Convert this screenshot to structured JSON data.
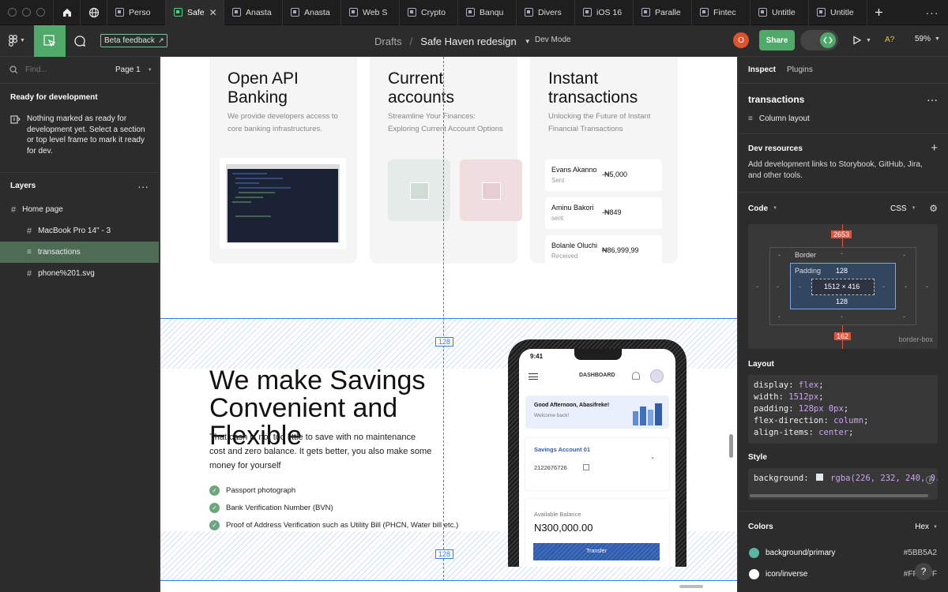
{
  "tabs": [
    {
      "label": "Perso",
      "active": false
    },
    {
      "label": "Safe",
      "active": true
    },
    {
      "label": "Anasta",
      "active": false
    },
    {
      "label": "Anasta",
      "active": false
    },
    {
      "label": "Web S",
      "active": false
    },
    {
      "label": "Crypto",
      "active": false
    },
    {
      "label": "Banqu",
      "active": false
    },
    {
      "label": "Divers",
      "active": false
    },
    {
      "label": "iOS 16",
      "active": false
    },
    {
      "label": "Paralle",
      "active": false
    },
    {
      "label": "Fintec",
      "active": false
    },
    {
      "label": "Untitle",
      "active": false
    },
    {
      "label": "Untitle",
      "active": false
    }
  ],
  "toolbar": {
    "beta_label": "Beta feedback",
    "breadcrumb_parent": "Drafts",
    "breadcrumb_sep": "/",
    "file_name": "Safe Haven redesign",
    "dev_mode": "Dev Mode",
    "avatar_initial": "O",
    "share_label": "Share",
    "font_badge": "A?",
    "zoom": "59%"
  },
  "left": {
    "find_placeholder": "Find...",
    "page_label": "Page 1",
    "ready_title": "Ready for development",
    "ready_text": "Nothing marked as ready for development yet. Select a section or top level frame to mark it ready for dev.",
    "layers_title": "Layers",
    "layers": [
      {
        "label": "Home page",
        "indent": false,
        "icon": "frame",
        "selected": false
      },
      {
        "label": "MacBook Pro 14\" - 3",
        "indent": true,
        "icon": "frame",
        "selected": false
      },
      {
        "label": "transactions",
        "indent": true,
        "icon": "column",
        "selected": true
      },
      {
        "label": "phone%201.svg",
        "indent": true,
        "icon": "frame",
        "selected": false
      }
    ]
  },
  "canvas": {
    "cards": [
      {
        "title": "Open API Banking",
        "desc": "We provide developers access to core banking infrastructures."
      },
      {
        "title": "Current accounts",
        "desc": "Streamline Your Finances: Exploring Current Account Options"
      },
      {
        "title": "Instant transactions",
        "desc": "Unlocking the Future of Instant Financial Transactions"
      }
    ],
    "transactions": [
      {
        "name": "Evans Akanno",
        "status": "Sent",
        "amount": "-₦5,000"
      },
      {
        "name": "Aminu Bakori",
        "status": "sent",
        "amount": "-₦849"
      },
      {
        "name": "Bolanle Oluchi",
        "status": "Received",
        "amount": "₦86,999,99"
      }
    ],
    "hero_title": "We make Savings Convenient and Flexible",
    "hero_text": "That cash is not too little to save with no maintenance cost and zero balance. It gets better, you also make some money for yourself",
    "checklist": [
      "Passport photograph",
      "Bank Verification Number (BVN)",
      "Proof of Address Verification such as Utility Bill (PHCN, Water bill etc.)"
    ],
    "padding_badge_top": "128",
    "padding_badge_bottom": "128",
    "phone": {
      "time": "9:41",
      "header": "DASHBOARD",
      "greeting": "Good Afternoon, Abasifreke!",
      "welcome": "Welcome back!",
      "account_name": "Savings Account 01",
      "account_number": "2122676726",
      "balance_label": "Available Balance",
      "balance": "N300,000.00",
      "transfer": "Transfer"
    }
  },
  "right": {
    "tabs": [
      "Inspect",
      "Plugins"
    ],
    "layer_name": "transactions",
    "layout_type": "Column layout",
    "dev_resources_title": "Dev resources",
    "dev_resources_text": "Add development links to Storybook, GitHub, Jira, and other tools.",
    "code_title": "Code",
    "code_lang": "CSS",
    "box": {
      "top": "2653",
      "border_label": "Border",
      "padding_label": "Padding",
      "padding_top": "128",
      "size": "1512 × 416",
      "padding_bottom": "128",
      "bottom": "162",
      "dash": "-",
      "sizing": "border-box"
    },
    "layout_title": "Layout",
    "layout_css": [
      {
        "prop": "display",
        "val": "flex"
      },
      {
        "prop": "width",
        "val": "1512px"
      },
      {
        "prop": "padding",
        "val": "128px 0px"
      },
      {
        "prop": "flex-direction",
        "val": "column"
      },
      {
        "prop": "align-items",
        "val": "center"
      }
    ],
    "style_title": "Style",
    "style_prop": "background:",
    "style_value": "rgba(226, 232, 240, 0.89",
    "colors_title": "Colors",
    "colors_format": "Hex",
    "colors": [
      {
        "name": "background/primary",
        "hex": "#5BB5A2",
        "swatch": "#5bb5a2"
      },
      {
        "name": "icon/inverse",
        "hex": "#FFFFFF",
        "swatch": "#ffffff"
      }
    ]
  },
  "accent": "#4fd07e",
  "selection_blue": "#2f80ed",
  "measure_red": "#e5533d"
}
